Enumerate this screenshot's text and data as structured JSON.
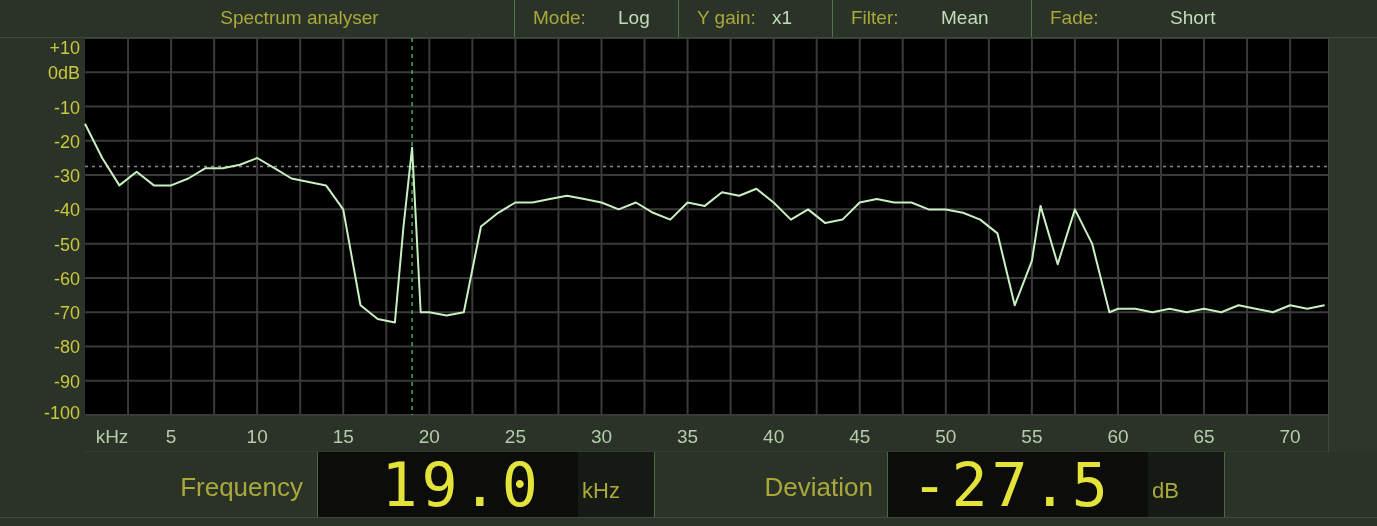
{
  "header": {
    "title": "Spectrum analyser",
    "settings": [
      {
        "label": "Mode:",
        "value": "Log"
      },
      {
        "label": "Y gain:",
        "value": "x1"
      },
      {
        "label": "Filter:",
        "value": "Mean"
      },
      {
        "label": "Fade:",
        "value": "Short"
      }
    ]
  },
  "chart_data": {
    "type": "line",
    "xlabel": "kHz",
    "xlim": [
      0,
      72.2
    ],
    "ylim": [
      -100,
      10
    ],
    "xticks": [
      5,
      10,
      15,
      20,
      25,
      30,
      35,
      40,
      45,
      50,
      55,
      60,
      65,
      70
    ],
    "yticks": [
      {
        "value": 10,
        "label": "+10"
      },
      {
        "value": 0,
        "label": "0dB"
      },
      -10,
      -20,
      -30,
      -40,
      -50,
      -60,
      -70,
      -80,
      -90,
      -100
    ],
    "x": [
      0,
      1,
      2,
      3,
      4,
      5,
      6,
      7,
      8,
      9,
      10,
      11,
      12,
      13,
      14,
      15,
      16,
      17,
      18,
      18.5,
      19,
      19.5,
      20,
      21,
      22,
      23,
      24,
      25,
      26,
      27,
      28,
      29,
      30,
      31,
      32,
      33,
      34,
      35,
      36,
      37,
      38,
      39,
      40,
      41,
      42,
      43,
      44,
      45,
      46,
      47,
      48,
      49,
      50,
      51,
      52,
      53,
      54,
      55,
      55.5,
      56.5,
      57.5,
      58.5,
      59.5,
      60,
      61,
      62,
      63,
      64,
      65,
      66,
      67,
      68,
      69,
      70,
      71,
      72
    ],
    "series": [
      {
        "color": "#c8f0c0",
        "values": [
          -15,
          -25,
          -33,
          -29,
          -33,
          -33,
          -31,
          -28,
          -28,
          -27,
          -25,
          -28,
          -31,
          -32,
          -33,
          -40,
          -68,
          -72,
          -73,
          -45,
          -22,
          -70,
          -70,
          -71,
          -70,
          -45,
          -41,
          -38,
          -38,
          -37,
          -36,
          -37,
          -38,
          -40,
          -38,
          -41,
          -43,
          -38,
          -39,
          -35,
          -36,
          -34,
          -38,
          -43,
          -40,
          -44,
          -43,
          -38,
          -37,
          -38,
          -38,
          -40,
          -40,
          -41,
          -43,
          -47,
          -68,
          -55,
          -39,
          -56,
          -40,
          -50,
          -70,
          -69,
          -69,
          -70,
          -69,
          -70,
          -69,
          -70,
          -68,
          -69,
          -70,
          -68,
          -69,
          -68
        ]
      }
    ],
    "grid": true,
    "ref_lines": [
      {
        "axis": "x",
        "value": 19
      },
      {
        "axis": "y",
        "value": -27.5
      }
    ]
  },
  "readouts": [
    {
      "label": "Frequency",
      "value": "19.0",
      "unit": "kHz"
    },
    {
      "label": "Deviation",
      "value": "-27.5",
      "unit": "dB"
    }
  ]
}
